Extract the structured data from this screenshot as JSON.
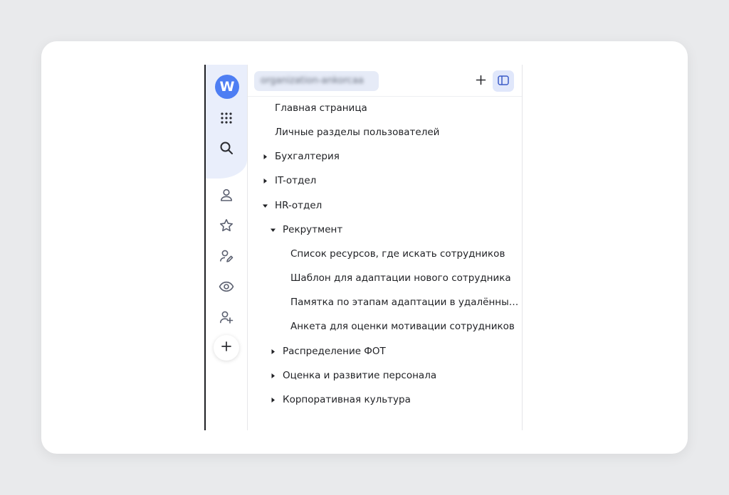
{
  "workspace": {
    "avatar_letter": "W",
    "org_name": "organization-ankorcaa",
    "accent": "#4e7ef3"
  },
  "rail": {
    "icons": [
      "apps-grid-icon",
      "search-icon",
      "user-icon",
      "star-icon",
      "user-edit-icon",
      "eye-icon",
      "user-add-icon",
      "plus-icon"
    ]
  },
  "tree": {
    "items": [
      {
        "label": "Главная страница",
        "caret": "none",
        "level": 0
      },
      {
        "label": "Личные разделы пользователей",
        "caret": "none",
        "level": 0
      },
      {
        "label": "Бухгалтерия",
        "caret": "collapsed",
        "level": 0
      },
      {
        "label": "IT-отдел",
        "caret": "collapsed",
        "level": 0
      },
      {
        "label": "HR-отдел",
        "caret": "expanded",
        "level": 0
      },
      {
        "label": "Рекрутмент",
        "caret": "expanded",
        "level": 1
      },
      {
        "label": "Список ресурсов, где искать сотрудников",
        "caret": "none",
        "level": 2
      },
      {
        "label": "Шаблон для адаптации нового сотрудника",
        "caret": "none",
        "level": 2
      },
      {
        "label": "Памятка по этапам адаптации в удалённых кома...",
        "caret": "none",
        "level": 2
      },
      {
        "label": "Анкета для оценки мотивации сотрудников",
        "caret": "none",
        "level": 2
      },
      {
        "label": "Распределение ФОТ",
        "caret": "collapsed",
        "level": 1
      },
      {
        "label": "Оценка и развитие персонала",
        "caret": "collapsed",
        "level": 1
      },
      {
        "label": "Корпоративная культура",
        "caret": "collapsed",
        "level": 1
      }
    ]
  }
}
